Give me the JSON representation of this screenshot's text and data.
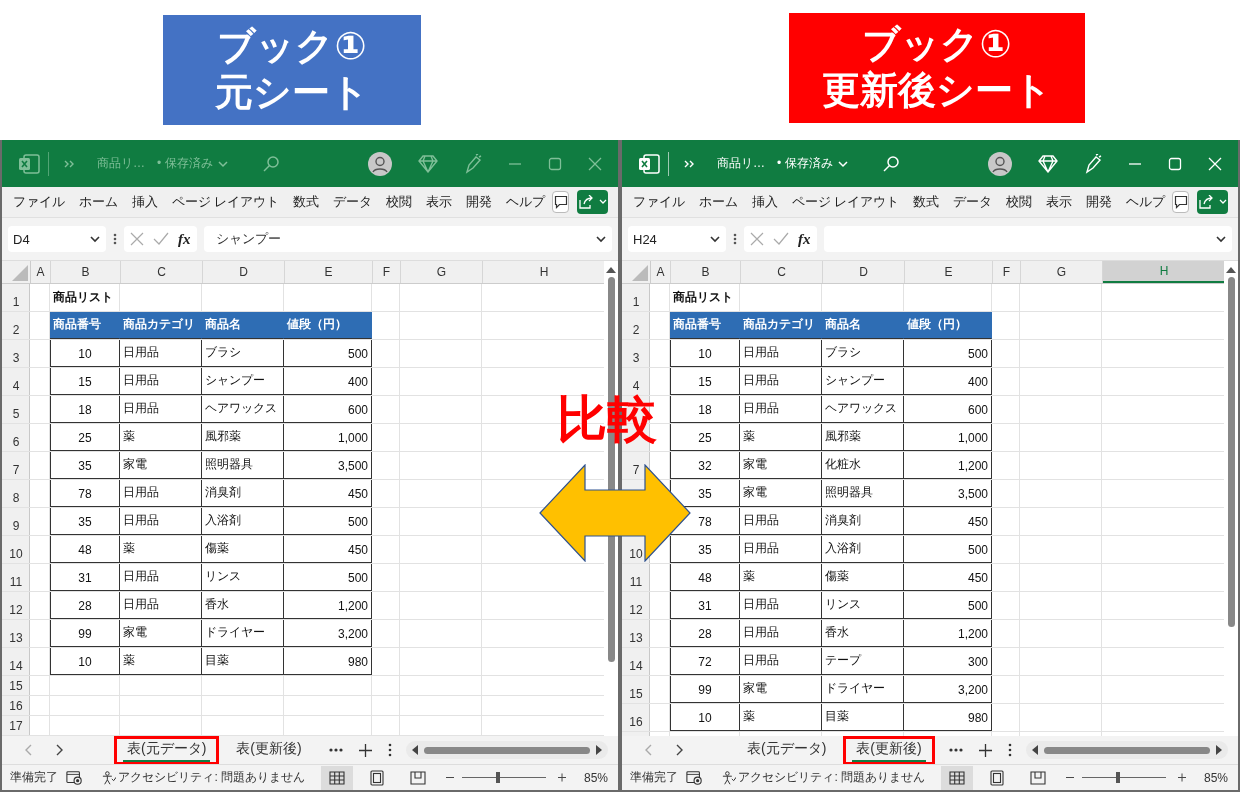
{
  "labels": [
    {
      "lines": [
        "ブック①",
        "元シート"
      ],
      "color": "#4472c4"
    },
    {
      "lines": [
        "ブック①",
        "更新後シート"
      ],
      "color": "#ff0000"
    }
  ],
  "comparison": {
    "label": "比較"
  },
  "windows": [
    {
      "active": false,
      "title": "商品リ…",
      "save_status": "• 保存済み",
      "ribbon_tabs": [
        "ファイル",
        "ホーム",
        "挿入",
        "ページ レイアウト",
        "数式",
        "データ",
        "校閲",
        "表示",
        "開発",
        "ヘルプ"
      ],
      "name_box": "D4",
      "formula_label": "fx",
      "formula": "シャンプー",
      "columns": [
        {
          "label": "A",
          "selected": false
        },
        {
          "label": "B",
          "selected": false
        },
        {
          "label": "C",
          "selected": false
        },
        {
          "label": "D",
          "selected": false
        },
        {
          "label": "E",
          "selected": false
        },
        {
          "label": "F",
          "selected": false
        },
        {
          "label": "G",
          "selected": false
        },
        {
          "label": "H",
          "selected": false
        }
      ],
      "sheet_rows": [
        {
          "number": "1",
          "kind": "title",
          "cells": [
            "商品リスト"
          ]
        },
        {
          "number": "2",
          "kind": "header",
          "cells": [
            "商品番号",
            "商品カテゴリ",
            "商品名",
            "値段（円）"
          ]
        },
        {
          "number": "3",
          "kind": "record",
          "cells": [
            "10",
            "日用品",
            "ブラシ",
            "500"
          ]
        },
        {
          "number": "4",
          "kind": "record",
          "cells": [
            "15",
            "日用品",
            "シャンプー",
            "400"
          ]
        },
        {
          "number": "5",
          "kind": "record",
          "cells": [
            "18",
            "日用品",
            "ヘアワックス",
            "600"
          ]
        },
        {
          "number": "6",
          "kind": "record",
          "cells": [
            "25",
            "薬",
            "風邪薬",
            "1,000"
          ]
        },
        {
          "number": "7",
          "kind": "record",
          "cells": [
            "35",
            "家電",
            "照明器具",
            "3,500"
          ]
        },
        {
          "number": "8",
          "kind": "record",
          "cells": [
            "78",
            "日用品",
            "消臭剤",
            "450"
          ]
        },
        {
          "number": "9",
          "kind": "record",
          "cells": [
            "35",
            "日用品",
            "入浴剤",
            "500"
          ]
        },
        {
          "number": "10",
          "kind": "record",
          "cells": [
            "48",
            "薬",
            "傷薬",
            "450"
          ]
        },
        {
          "number": "11",
          "kind": "record",
          "cells": [
            "31",
            "日用品",
            "リンス",
            "500"
          ]
        },
        {
          "number": "12",
          "kind": "record",
          "cells": [
            "28",
            "日用品",
            "香水",
            "1,200"
          ]
        },
        {
          "number": "13",
          "kind": "record",
          "cells": [
            "99",
            "家電",
            "ドライヤー",
            "3,200"
          ]
        },
        {
          "number": "14",
          "kind": "record",
          "cells": [
            "10",
            "薬",
            "目薬",
            "980"
          ]
        },
        {
          "number": "15",
          "kind": "empty"
        },
        {
          "number": "16",
          "kind": "empty"
        },
        {
          "number": "17",
          "kind": "empty"
        }
      ],
      "sheets": [
        {
          "label": "表(元データ)",
          "selected": true,
          "annotated": true
        },
        {
          "label": "表(更新後)",
          "selected": false,
          "annotated": false
        }
      ],
      "status": "準備完了",
      "accessibility": "アクセシビリティ: 問題ありません",
      "views": [
        {
          "kind": "normal",
          "selected": true
        },
        {
          "kind": "page_layout",
          "selected": false
        },
        {
          "kind": "page_break",
          "selected": false
        }
      ],
      "zoom": {
        "level": 0.43,
        "reading": "85%"
      }
    },
    {
      "active": true,
      "title": "商品リ…",
      "save_status": "• 保存済み",
      "ribbon_tabs": [
        "ファイル",
        "ホーム",
        "挿入",
        "ページ レイアウト",
        "数式",
        "データ",
        "校閲",
        "表示",
        "開発",
        "ヘルプ"
      ],
      "name_box": "H24",
      "formula_label": "fx",
      "columns": [
        {
          "label": "A",
          "selected": false
        },
        {
          "label": "B",
          "selected": false
        },
        {
          "label": "C",
          "selected": false
        },
        {
          "label": "D",
          "selected": false
        },
        {
          "label": "E",
          "selected": false
        },
        {
          "label": "F",
          "selected": false
        },
        {
          "label": "G",
          "selected": false
        },
        {
          "label": "H",
          "selected": true
        }
      ],
      "sheet_rows": [
        {
          "number": "1",
          "kind": "title",
          "cells": [
            "商品リスト"
          ]
        },
        {
          "number": "2",
          "kind": "header",
          "cells": [
            "商品番号",
            "商品カテゴリ",
            "商品名",
            "値段（円）"
          ]
        },
        {
          "number": "3",
          "kind": "record",
          "cells": [
            "10",
            "日用品",
            "ブラシ",
            "500"
          ]
        },
        {
          "number": "4",
          "kind": "record",
          "cells": [
            "15",
            "日用品",
            "シャンプー",
            "400"
          ]
        },
        {
          "kind": "record",
          "cells": [
            "18",
            "日用品",
            "ヘアワックス",
            "600"
          ]
        },
        {
          "kind": "record",
          "cells": [
            "25",
            "薬",
            "風邪薬",
            "1,000"
          ]
        },
        {
          "number": "7",
          "kind": "record",
          "cells": [
            "32",
            "家電",
            "化粧水",
            "1,200"
          ]
        },
        {
          "kind": "record",
          "cells": [
            "35",
            "家電",
            "照明器具",
            "3,500"
          ]
        },
        {
          "kind": "record",
          "cells": [
            "78",
            "日用品",
            "消臭剤",
            "450"
          ]
        },
        {
          "number": "10",
          "kind": "record",
          "cells": [
            "35",
            "日用品",
            "入浴剤",
            "500"
          ]
        },
        {
          "number": "11",
          "kind": "record",
          "cells": [
            "48",
            "薬",
            "傷薬",
            "450"
          ]
        },
        {
          "number": "12",
          "kind": "record",
          "cells": [
            "31",
            "日用品",
            "リンス",
            "500"
          ]
        },
        {
          "number": "13",
          "kind": "record",
          "cells": [
            "28",
            "日用品",
            "香水",
            "1,200"
          ]
        },
        {
          "number": "14",
          "kind": "record",
          "cells": [
            "72",
            "日用品",
            "テープ",
            "300"
          ]
        },
        {
          "number": "15",
          "kind": "record",
          "cells": [
            "99",
            "家電",
            "ドライヤー",
            "3,200"
          ]
        },
        {
          "number": "16",
          "kind": "record",
          "cells": [
            "10",
            "薬",
            "目薬",
            "980"
          ]
        }
      ],
      "sheets": [
        {
          "label": "表(元データ)",
          "selected": false,
          "annotated": false
        },
        {
          "label": "表(更新後)",
          "selected": true,
          "annotated": true
        }
      ],
      "status": "準備完了",
      "accessibility": "アクセシビリティ: 問題ありません",
      "views": [
        {
          "kind": "normal",
          "selected": true
        },
        {
          "kind": "page_layout",
          "selected": false
        },
        {
          "kind": "page_break",
          "selected": false
        }
      ],
      "zoom": {
        "level": 0.43,
        "reading": "85%"
      }
    }
  ]
}
